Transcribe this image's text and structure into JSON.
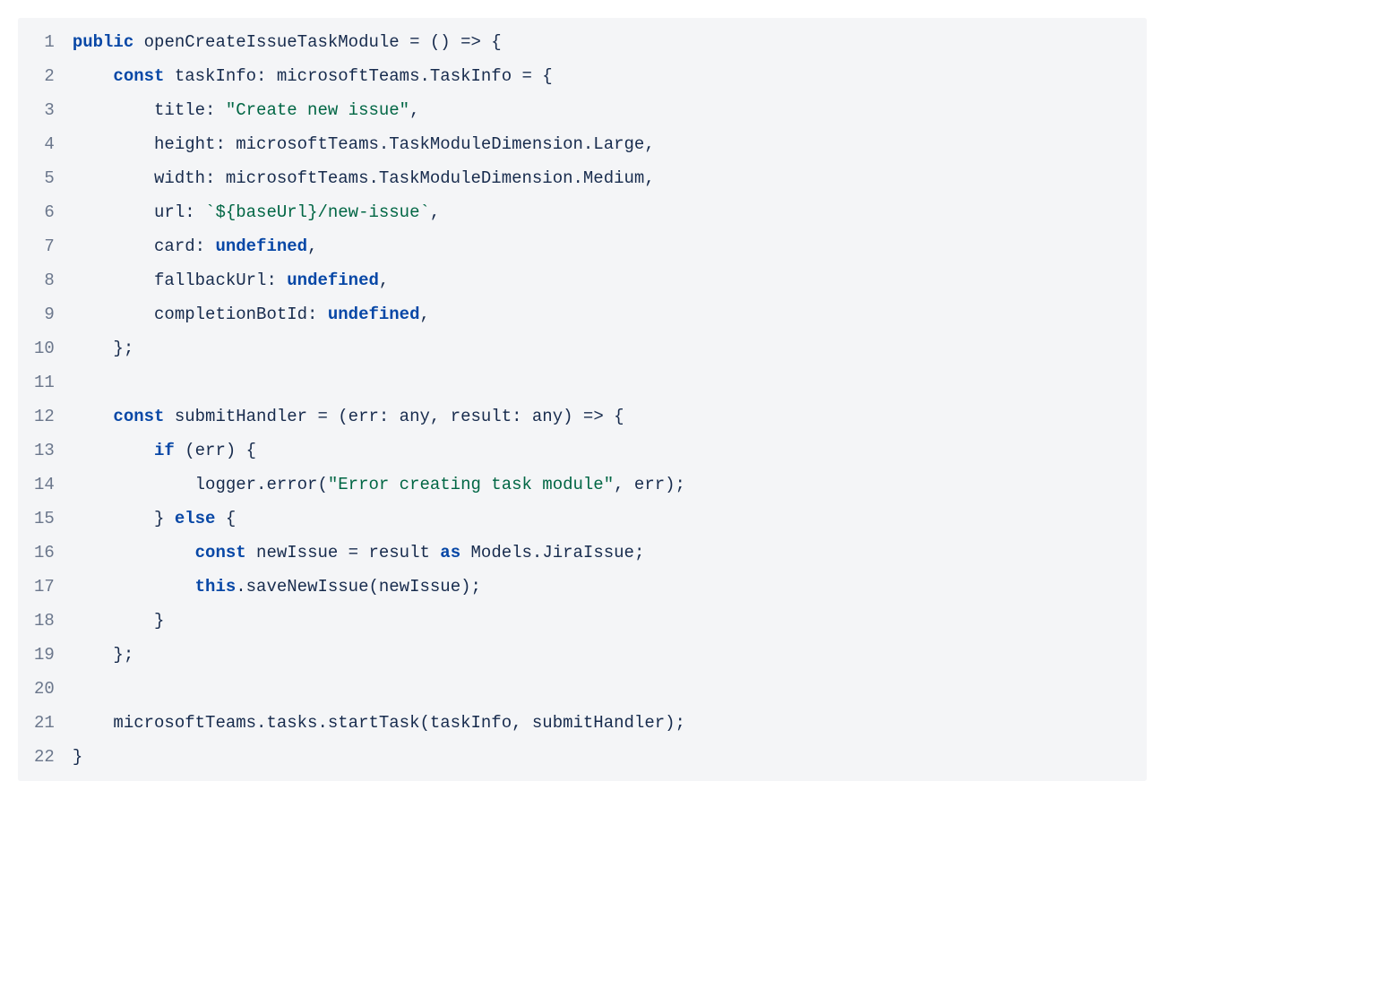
{
  "code": {
    "lineCount": 22,
    "lines": [
      [
        {
          "t": "public",
          "c": "kw"
        },
        {
          "t": " openCreateIssueTaskModule = () => {",
          "c": "plain"
        }
      ],
      [
        {
          "t": "    ",
          "c": "plain"
        },
        {
          "t": "const",
          "c": "kw"
        },
        {
          "t": " taskInfo: microsoftTeams.TaskInfo = {",
          "c": "plain"
        }
      ],
      [
        {
          "t": "        title: ",
          "c": "plain"
        },
        {
          "t": "\"Create new issue\"",
          "c": "str"
        },
        {
          "t": ",",
          "c": "plain"
        }
      ],
      [
        {
          "t": "        height: microsoftTeams.TaskModuleDimension.Large,",
          "c": "plain"
        }
      ],
      [
        {
          "t": "        width: microsoftTeams.TaskModuleDimension.Medium,",
          "c": "plain"
        }
      ],
      [
        {
          "t": "        url: ",
          "c": "plain"
        },
        {
          "t": "`${baseUrl}",
          "c": "str"
        },
        {
          "t": "/new-issue`",
          "c": "str"
        },
        {
          "t": ",",
          "c": "plain"
        }
      ],
      [
        {
          "t": "        card: ",
          "c": "plain"
        },
        {
          "t": "undefined",
          "c": "kw"
        },
        {
          "t": ",",
          "c": "plain"
        }
      ],
      [
        {
          "t": "        fallbackUrl: ",
          "c": "plain"
        },
        {
          "t": "undefined",
          "c": "kw"
        },
        {
          "t": ",",
          "c": "plain"
        }
      ],
      [
        {
          "t": "        completionBotId: ",
          "c": "plain"
        },
        {
          "t": "undefined",
          "c": "kw"
        },
        {
          "t": ",",
          "c": "plain"
        }
      ],
      [
        {
          "t": "    };",
          "c": "plain"
        }
      ],
      [
        {
          "t": "",
          "c": "plain"
        }
      ],
      [
        {
          "t": "    ",
          "c": "plain"
        },
        {
          "t": "const",
          "c": "kw"
        },
        {
          "t": " submitHandler = (err: any, result: any) => {",
          "c": "plain"
        }
      ],
      [
        {
          "t": "        ",
          "c": "plain"
        },
        {
          "t": "if",
          "c": "kw"
        },
        {
          "t": " (err) {",
          "c": "plain"
        }
      ],
      [
        {
          "t": "            logger.error(",
          "c": "plain"
        },
        {
          "t": "\"Error creating task module\"",
          "c": "str"
        },
        {
          "t": ", err);",
          "c": "plain"
        }
      ],
      [
        {
          "t": "        } ",
          "c": "plain"
        },
        {
          "t": "else",
          "c": "kw"
        },
        {
          "t": " {",
          "c": "plain"
        }
      ],
      [
        {
          "t": "            ",
          "c": "plain"
        },
        {
          "t": "const",
          "c": "kw"
        },
        {
          "t": " newIssue = result ",
          "c": "plain"
        },
        {
          "t": "as",
          "c": "kw"
        },
        {
          "t": " Models.JiraIssue;",
          "c": "plain"
        }
      ],
      [
        {
          "t": "            ",
          "c": "plain"
        },
        {
          "t": "this",
          "c": "kw"
        },
        {
          "t": ".saveNewIssue(newIssue);",
          "c": "plain"
        }
      ],
      [
        {
          "t": "        }",
          "c": "plain"
        }
      ],
      [
        {
          "t": "    };",
          "c": "plain"
        }
      ],
      [
        {
          "t": "",
          "c": "plain"
        }
      ],
      [
        {
          "t": "    microsoftTeams.tasks.startTask(taskInfo, submitHandler);",
          "c": "plain"
        }
      ],
      [
        {
          "t": "}",
          "c": "plain"
        }
      ]
    ]
  }
}
